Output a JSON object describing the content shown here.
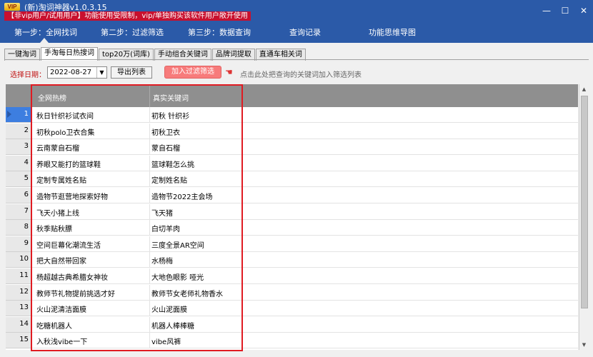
{
  "window": {
    "badge": "VIP",
    "title": "(新)淘词神器v1.0.3.15",
    "notice": "【非vip用户/试用用户】功能使用受限制，vip/单独购买该软件用户敞开使用",
    "minimize": "—",
    "maximize": "☐",
    "close": "✕"
  },
  "steps": [
    {
      "label": "第一步：全网找词"
    },
    {
      "label": "第二步：过滤筛选"
    },
    {
      "label": "第三步：数据查询"
    },
    {
      "label": "查询记录"
    },
    {
      "label": "功能思维导图"
    }
  ],
  "tabs": [
    {
      "label": "一键淘词"
    },
    {
      "label": "手淘每日热搜词"
    },
    {
      "label": "top20万(词库)"
    },
    {
      "label": "手动组合关键词"
    },
    {
      "label": "品牌词提取"
    },
    {
      "label": "直通车相关词"
    }
  ],
  "filter": {
    "date_label": "选择日期：",
    "date_value": "2022-08-27",
    "export_label": "导出列表",
    "add_label": "加入过滤筛选",
    "hint": "点击此处把查询的关键词加入筛选列表"
  },
  "table": {
    "columns": [
      "全网热榜",
      "真实关键词"
    ],
    "rows": [
      {
        "num": "1",
        "hot": "秋日针织衫试衣间",
        "real": "初秋 针织衫"
      },
      {
        "num": "2",
        "hot": "初秋polo卫衣合集",
        "real": "初秋卫衣"
      },
      {
        "num": "3",
        "hot": "云南蒙自石榴",
        "real": "蒙自石榴"
      },
      {
        "num": "4",
        "hot": "养眼又能打的篮球鞋",
        "real": "篮球鞋怎么挑"
      },
      {
        "num": "5",
        "hot": "定制专属姓名贴",
        "real": "定制姓名贴"
      },
      {
        "num": "6",
        "hot": "造物节逛营地探索好物",
        "real": "造物节2022主会场"
      },
      {
        "num": "7",
        "hot": "飞天小猪上线",
        "real": "飞天猪"
      },
      {
        "num": "8",
        "hot": "秋季贴秋膘",
        "real": "白切羊肉"
      },
      {
        "num": "9",
        "hot": "空间巨幕化潮流生活",
        "real": "三度全景AR空间"
      },
      {
        "num": "10",
        "hot": "把大自然带回家",
        "real": "水杨梅"
      },
      {
        "num": "11",
        "hot": "杨超越古典希腊女神妆",
        "real": "大地色眼影 哑光"
      },
      {
        "num": "12",
        "hot": "教师节礼物提前挑选才好",
        "real": "教师节女老师礼物香水"
      },
      {
        "num": "13",
        "hot": "火山泥清洁面膜",
        "real": "火山泥面膜"
      },
      {
        "num": "14",
        "hot": "吃糖机器人",
        "real": "机器人棒棒糖"
      },
      {
        "num": "15",
        "hot": "入秋浅vibe一下",
        "real": "vibe风裤"
      }
    ]
  },
  "icons": {
    "pointer": "hand-pointer-icon",
    "dropdown": "chevron-down-icon",
    "row_indicator": "triangle-right-icon"
  },
  "colors": {
    "titlebar": "#2b5aa8",
    "notice_bg": "#c8102e",
    "add_button": "#f77b7b",
    "highlight_border": "#e01b22",
    "date_label": "#c01010"
  }
}
